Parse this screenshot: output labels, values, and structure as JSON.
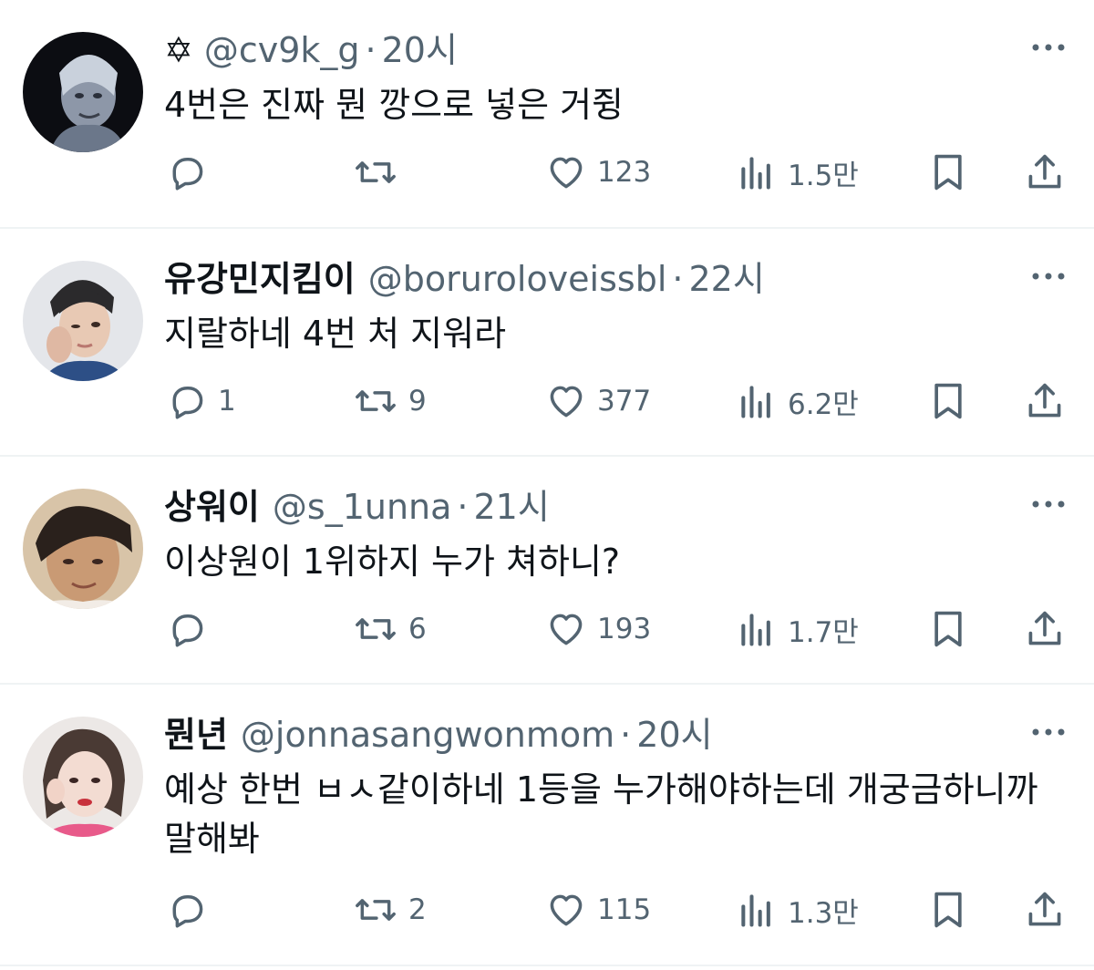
{
  "tweets": [
    {
      "name": "",
      "name_prefix": "✡",
      "handle": "@cv9k_g",
      "dot": "·",
      "time": "20시",
      "text": "4번은 진짜 뭔 깡으로 넣은 거쥥",
      "replies": "",
      "retweets": "",
      "likes": "123",
      "views": "1.5만"
    },
    {
      "name": "유강민지킴이",
      "handle": "@boruroloveissbl",
      "dot": "·",
      "time": "22시",
      "text": "지랄하네 4번 처 지워라",
      "replies": "1",
      "retweets": "9",
      "likes": "377",
      "views": "6.2만"
    },
    {
      "name": "상워이",
      "handle": "@s_1unna",
      "dot": "·",
      "time": "21시",
      "text": "이상원이 1위하지 누가 쳐하니?",
      "replies": "",
      "retweets": "6",
      "likes": "193",
      "views": "1.7만"
    },
    {
      "name": "뭔년",
      "handle": "@jonnasangwonmom",
      "dot": "·",
      "time": "20시",
      "text": "예상 한번 ㅂㅅ같이하네 1등을 누가해야하는데 개궁금하니까 말해봐",
      "replies": "",
      "retweets": "2",
      "likes": "115",
      "views": "1.3만"
    }
  ],
  "icons": {
    "reply": "reply-icon",
    "retweet": "retweet-icon",
    "like": "heart-icon",
    "views": "views-chart-icon",
    "bookmark": "bookmark-icon",
    "share": "share-icon",
    "more": "more-dots-icon"
  },
  "colors": {
    "text": "#0f1419",
    "secondary": "#536471",
    "divider": "#eff3f4"
  }
}
